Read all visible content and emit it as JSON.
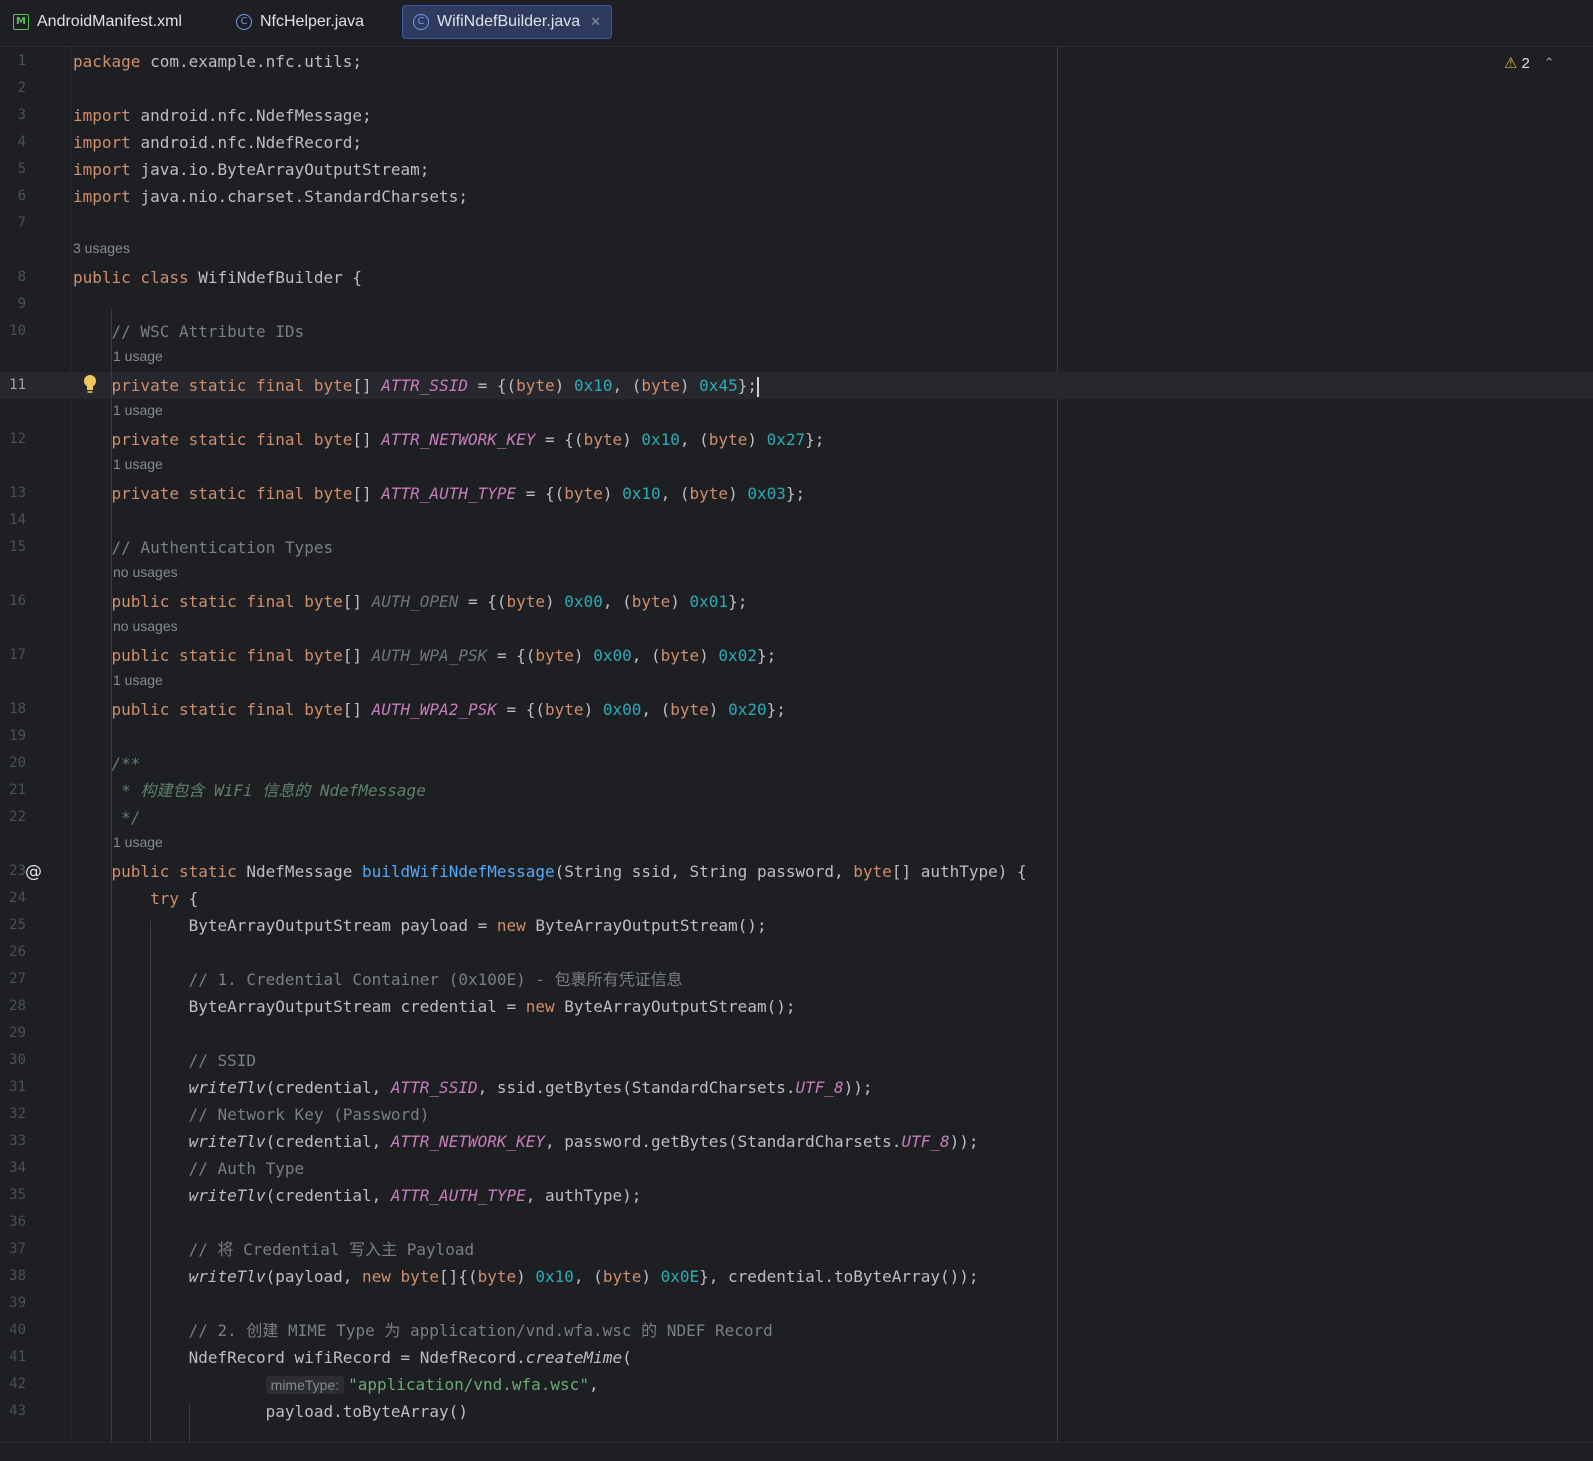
{
  "tabs": [
    {
      "label": "AndroidManifest.xml",
      "icon": "manifest-icon",
      "active": false
    },
    {
      "label": "NfcHelper.java",
      "icon": "class-icon",
      "active": false
    },
    {
      "label": "WifiNdefBuilder.java",
      "icon": "class-icon",
      "active": true
    }
  ],
  "inspection": {
    "warning_count": "2"
  },
  "param_hint": "mimeType:",
  "hints": {
    "h8": "3 usages",
    "h11": "1 usage",
    "h12": "1 usage",
    "h13": "1 usage",
    "h16": "no usages",
    "h17": "no usages",
    "h18": "1 usage",
    "h23": "1 usage"
  },
  "lines": [
    {
      "n": "1",
      "segs": [
        [
          "kw",
          "package"
        ],
        [
          "",
          "com.example.nfc.utils;"
        ]
      ]
    },
    {
      "n": "2",
      "segs": []
    },
    {
      "n": "3",
      "segs": [
        [
          "kw",
          "import"
        ],
        [
          "",
          "android.nfc.NdefMessage;"
        ]
      ]
    },
    {
      "n": "4",
      "segs": [
        [
          "kw",
          "import"
        ],
        [
          "",
          "android.nfc.NdefRecord;"
        ]
      ]
    },
    {
      "n": "5",
      "segs": [
        [
          "kw",
          "import"
        ],
        [
          "",
          "java.io.ByteArrayOutputStream;"
        ]
      ]
    },
    {
      "n": "6",
      "segs": [
        [
          "kw",
          "import"
        ],
        [
          "",
          "java.nio.charset.StandardCharsets;"
        ]
      ]
    },
    {
      "n": "7",
      "segs": []
    },
    {
      "n": "8",
      "segs": [
        [
          "kw",
          "public class"
        ],
        [
          "",
          "WifiNdefBuilder {"
        ]
      ]
    },
    {
      "n": "9",
      "segs": []
    },
    {
      "n": "10",
      "segs": [
        [
          "cm",
          "    // WSC Attribute IDs"
        ]
      ]
    },
    {
      "n": "11",
      "segs": [
        [
          "kw",
          "    private static final byte"
        ],
        [
          "",
          "[] "
        ],
        [
          "cst",
          "ATTR_SSID"
        ],
        [
          "",
          " = {("
        ],
        [
          "kw",
          "byte"
        ],
        [
          "",
          ") "
        ],
        [
          "num",
          "0x10"
        ],
        [
          "",
          ", ("
        ],
        [
          "kw",
          "byte"
        ],
        [
          "",
          ") "
        ],
        [
          "num",
          "0x45"
        ],
        [
          "",
          "};"
        ]
      ]
    },
    {
      "n": "12",
      "segs": [
        [
          "kw",
          "    private static final byte"
        ],
        [
          "",
          "[] "
        ],
        [
          "cst",
          "ATTR_NETWORK_KEY"
        ],
        [
          "",
          " = {("
        ],
        [
          "kw",
          "byte"
        ],
        [
          "",
          ") "
        ],
        [
          "num",
          "0x10"
        ],
        [
          "",
          ", ("
        ],
        [
          "kw",
          "byte"
        ],
        [
          "",
          ") "
        ],
        [
          "num",
          "0x27"
        ],
        [
          "",
          "};"
        ]
      ]
    },
    {
      "n": "13",
      "segs": [
        [
          "kw",
          "    private static final byte"
        ],
        [
          "",
          "[] "
        ],
        [
          "cst",
          "ATTR_AUTH_TYPE"
        ],
        [
          "",
          " = {("
        ],
        [
          "kw",
          "byte"
        ],
        [
          "",
          ") "
        ],
        [
          "num",
          "0x10"
        ],
        [
          "",
          ", ("
        ],
        [
          "kw",
          "byte"
        ],
        [
          "",
          ") "
        ],
        [
          "num",
          "0x03"
        ],
        [
          "",
          "};"
        ]
      ]
    },
    {
      "n": "14",
      "segs": []
    },
    {
      "n": "15",
      "segs": [
        [
          "cm",
          "    // Authentication Types"
        ]
      ]
    },
    {
      "n": "16",
      "segs": [
        [
          "kw",
          "    public static final byte"
        ],
        [
          "",
          "[] "
        ],
        [
          "cst-un",
          "AUTH_OPEN"
        ],
        [
          "",
          " = {("
        ],
        [
          "kw",
          "byte"
        ],
        [
          "",
          ") "
        ],
        [
          "num",
          "0x00"
        ],
        [
          "",
          ", ("
        ],
        [
          "kw",
          "byte"
        ],
        [
          "",
          ") "
        ],
        [
          "num",
          "0x01"
        ],
        [
          "",
          "};"
        ]
      ]
    },
    {
      "n": "17",
      "segs": [
        [
          "kw",
          "    public static final byte"
        ],
        [
          "",
          "[] "
        ],
        [
          "cst-un",
          "AUTH_WPA_PSK"
        ],
        [
          "",
          " = {("
        ],
        [
          "kw",
          "byte"
        ],
        [
          "",
          ") "
        ],
        [
          "num",
          "0x00"
        ],
        [
          "",
          ", ("
        ],
        [
          "kw",
          "byte"
        ],
        [
          "",
          ") "
        ],
        [
          "num",
          "0x02"
        ],
        [
          "",
          "};"
        ]
      ]
    },
    {
      "n": "18",
      "segs": [
        [
          "kw",
          "    public static final byte"
        ],
        [
          "",
          "[] "
        ],
        [
          "cst",
          "AUTH_WPA2_PSK"
        ],
        [
          "",
          " = {("
        ],
        [
          "kw",
          "byte"
        ],
        [
          "",
          ") "
        ],
        [
          "num",
          "0x00"
        ],
        [
          "",
          ", ("
        ],
        [
          "kw",
          "byte"
        ],
        [
          "",
          ") "
        ],
        [
          "num",
          "0x20"
        ],
        [
          "",
          "};"
        ]
      ]
    },
    {
      "n": "19",
      "segs": []
    },
    {
      "n": "20",
      "segs": [
        [
          "doc",
          "    /**"
        ]
      ]
    },
    {
      "n": "21",
      "segs": [
        [
          "doc",
          "     * 构建包含 WiFi 信息的 NdefMessage"
        ]
      ]
    },
    {
      "n": "22",
      "segs": [
        [
          "doc",
          "     */"
        ]
      ]
    },
    {
      "n": "23",
      "segs": [
        [
          "kw",
          "    public static"
        ],
        [
          "",
          " NdefMessage "
        ],
        [
          "fn",
          "buildWifiNdefMessage"
        ],
        [
          "",
          "(String ssid, String password, "
        ],
        [
          "kw",
          "byte"
        ],
        [
          "",
          "[] authType) {"
        ]
      ]
    },
    {
      "n": "24",
      "segs": [
        [
          "kw",
          "        try"
        ],
        [
          "",
          " {"
        ]
      ]
    },
    {
      "n": "25",
      "segs": [
        [
          "",
          "            ByteArrayOutputStream payload = "
        ],
        [
          "kw",
          "new"
        ],
        [
          "",
          " ByteArrayOutputStream();"
        ]
      ]
    },
    {
      "n": "26",
      "segs": []
    },
    {
      "n": "27",
      "segs": [
        [
          "cm",
          "            // 1. Credential Container (0x100E) - 包裹所有凭证信息"
        ]
      ]
    },
    {
      "n": "28",
      "segs": [
        [
          "",
          "            ByteArrayOutputStream credential = "
        ],
        [
          "kw",
          "new"
        ],
        [
          "",
          " ByteArrayOutputStream();"
        ]
      ]
    },
    {
      "n": "29",
      "segs": []
    },
    {
      "n": "30",
      "segs": [
        [
          "cm",
          "            // SSID"
        ]
      ]
    },
    {
      "n": "31",
      "segs": [
        [
          "sfn",
          "            writeTlv"
        ],
        [
          "",
          "(credential, "
        ],
        [
          "cst",
          "ATTR_SSID"
        ],
        [
          "",
          ", ssid.getBytes(StandardCharsets."
        ],
        [
          "cst",
          "UTF_8"
        ],
        [
          "",
          "));"
        ]
      ]
    },
    {
      "n": "32",
      "segs": [
        [
          "cm",
          "            // Network Key (Password)"
        ]
      ]
    },
    {
      "n": "33",
      "segs": [
        [
          "sfn",
          "            writeTlv"
        ],
        [
          "",
          "(credential, "
        ],
        [
          "cst",
          "ATTR_NETWORK_KEY"
        ],
        [
          "",
          ", password.getBytes(StandardCharsets."
        ],
        [
          "cst",
          "UTF_8"
        ],
        [
          "",
          "));"
        ]
      ]
    },
    {
      "n": "34",
      "segs": [
        [
          "cm",
          "            // Auth Type"
        ]
      ]
    },
    {
      "n": "35",
      "segs": [
        [
          "sfn",
          "            writeTlv"
        ],
        [
          "",
          "(credential, "
        ],
        [
          "cst",
          "ATTR_AUTH_TYPE"
        ],
        [
          "",
          ", authType);"
        ]
      ]
    },
    {
      "n": "36",
      "segs": []
    },
    {
      "n": "37",
      "segs": [
        [
          "cm",
          "            // 将 Credential 写入主 Payload"
        ]
      ]
    },
    {
      "n": "38",
      "segs": [
        [
          "sfn",
          "            writeTlv"
        ],
        [
          "",
          "(payload, "
        ],
        [
          "kw",
          "new byte"
        ],
        [
          "",
          "[]{("
        ],
        [
          "kw",
          "byte"
        ],
        [
          "",
          ") "
        ],
        [
          "num",
          "0x10"
        ],
        [
          "",
          ", ("
        ],
        [
          "kw",
          "byte"
        ],
        [
          "",
          ") "
        ],
        [
          "num",
          "0x0E"
        ],
        [
          "",
          "}, credential.toByteArray());"
        ]
      ]
    },
    {
      "n": "39",
      "segs": []
    },
    {
      "n": "40",
      "segs": [
        [
          "cm",
          "            // 2. 创建 MIME Type 为 application/vnd.wfa.wsc 的 NDEF Record"
        ]
      ]
    },
    {
      "n": "41",
      "segs": [
        [
          "",
          "            NdefRecord wifiRecord = NdefRecord."
        ],
        [
          "sfn",
          "createMime"
        ],
        [
          "",
          "("
        ]
      ]
    },
    {
      "n": "42",
      "segs": [
        [
          "",
          "                    "
        ],
        [
          "hint",
          "mimeType:"
        ],
        [
          "str",
          "\"application/vnd.wfa.wsc\""
        ],
        [
          "",
          ","
        ]
      ]
    },
    {
      "n": "43",
      "segs": [
        [
          "",
          "                    payload.toByteArray()"
        ]
      ]
    }
  ]
}
